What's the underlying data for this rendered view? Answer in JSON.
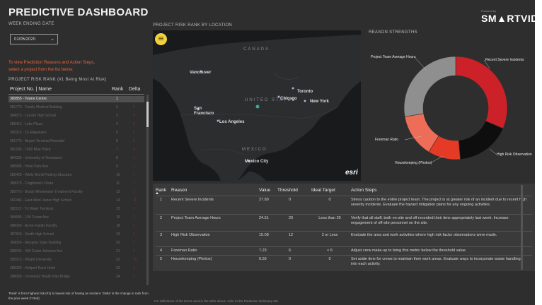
{
  "header": {
    "title": "PREDICTIVE DASHBOARD",
    "brand_tag": "Powered by",
    "brand": "SM▲RTVID.IO"
  },
  "filters": {
    "week_label": "WEEK ENDING DATE",
    "week_value": "01/05/2020"
  },
  "instructions": [
    "To view Prediction Reasons and Action Steps,",
    "select a project from the list below."
  ],
  "project_list": {
    "title": "PROJECT RISK RANK (#1 Being Most At Risk)",
    "headers": [
      "Project No. | Name",
      "Rank",
      "Delta"
    ],
    "rows": [
      {
        "name": "380855 - Towne Centre",
        "rank": "1",
        "delta": "0"
      },
      {
        "name": "381779 - Family Medical Building",
        "rank": "2",
        "delta": "0"
      },
      {
        "name": "384573 - Lincoln High School",
        "rank": "3",
        "delta": "0"
      },
      {
        "name": "389415 - Lake Plaza",
        "rank": "4",
        "delta": "0"
      },
      {
        "name": "390215 - 15 Edgewater",
        "rank": "5",
        "delta": "0"
      },
      {
        "name": "391775 - Airport Terminal Remodel",
        "rank": "6",
        "delta": "0"
      },
      {
        "name": "381295 - 1000 Blue Plaza",
        "rank": "7",
        "delta": "0"
      },
      {
        "name": "384335 - University of Tennessee",
        "rank": "8",
        "delta": "1"
      },
      {
        "name": "385995 - Hotel Park Ave",
        "rank": "9",
        "delta": "1"
      },
      {
        "name": "386425 - Wells World Parking Structure",
        "rank": "10",
        "delta": "1"
      },
      {
        "name": "389075 - Ciagbonet's Plaza",
        "rank": "11",
        "delta": "1"
      },
      {
        "name": "389775 - Brady Wholewater Treatment Facility",
        "rank": "12",
        "delta": "1"
      },
      {
        "name": "391484 - East West Junior High School",
        "rank": "14",
        "delta": "11"
      },
      {
        "name": "382115 - Tri Water Terminal",
        "rank": "15",
        "delta": "2"
      },
      {
        "name": "384685 - 100 Crown Ave",
        "rank": "16",
        "delta": "2"
      },
      {
        "name": "386005 - Acme Family Facility",
        "rank": "18",
        "delta": "2"
      },
      {
        "name": "387555 - Smith High School",
        "rank": "19",
        "delta": "2"
      },
      {
        "name": "389055 - Mesaine State Building",
        "rank": "20",
        "delta": "2"
      },
      {
        "name": "389034 - 400 Cedar Johnson Ave",
        "rank": "21",
        "delta": "2"
      },
      {
        "name": "385215 - Wright University",
        "rank": "22",
        "delta": "10"
      },
      {
        "name": "385025 - Heliport Rock Hotel",
        "rank": "23",
        "delta": "2"
      },
      {
        "name": "388085 - University Health Pan Bridge",
        "rank": "24",
        "delta": "2"
      }
    ]
  },
  "map": {
    "title": "PROJECT RISK RANK BY LOCATION",
    "countries": [
      "CANADA",
      "UNITED STATES",
      "MEXICO"
    ],
    "cities": [
      "Vancouver",
      "Toronto",
      "Chicago",
      "New York",
      "San Francisco",
      "Los Angeles",
      "Mexico City"
    ],
    "attribution": "esri"
  },
  "reason_strengths": {
    "title": "REASON STRENGTHS",
    "segments": [
      {
        "label": "Recent Severe Incidents",
        "value": 27.89,
        "color": "#cc2128"
      },
      {
        "label": "High Risk Observation",
        "value": 15.08,
        "color": "#0e0e0e"
      },
      {
        "label": "Housekeeping (Photos)",
        "value": 9.0,
        "color": "#e53a26"
      },
      {
        "label": "Foreman Ratio",
        "value": 12.0,
        "color": "#ed6d58"
      },
      {
        "label": "Project Team Average Hours",
        "value": 24.51,
        "color": "#8f8f8f"
      }
    ]
  },
  "reasons_table": {
    "headers": [
      "Rank",
      "Reason",
      "Value",
      "Threshold",
      "Ideal Target",
      "Action Steps"
    ],
    "rows": [
      {
        "rank": "1",
        "reason": "Recent Severe Incidents",
        "value": "27.89",
        "threshold": "0",
        "target": "0",
        "action": "Stress caution to the entire project team. The project is at greater risk of an incident due to recent high severity incidents. Evaluate the hazard mitigation plans for any ongoing activities."
      },
      {
        "rank": "2",
        "reason": "Project Team Average Hours",
        "value": "24.51",
        "threshold": "20",
        "target": "Less than 20",
        "action": "Verify that all staff, both on-site and off recorded their time appropriately last week. Increase engagement of off-site personnel on the site."
      },
      {
        "rank": "3",
        "reason": "High Risk Observation",
        "value": "15.08",
        "threshold": "12",
        "target": "2 or Less",
        "action": "Evaluate the area and work activities where high risk factor observations were made."
      },
      {
        "rank": "4",
        "reason": "Foreman Ratio",
        "value": "7.23",
        "threshold": "6",
        "target": "< 6",
        "action": "Adjust crew make-up to bring this metric below the threshold value."
      },
      {
        "rank": "5",
        "reason": "Housekeeping (Photos)",
        "value": "0.59",
        "threshold": "0",
        "target": "0",
        "action": "Set aside time for crews to maintain their work areas. Evaluate ways to incorporate waste handling into each activity."
      }
    ]
  },
  "footnotes": {
    "left": "'Rank' is from highest risk (#1) to lowest risk of having an incident. 'Delta' is the change in rank from the prior week (* Red)",
    "bottom": "For definitions of the terms used in the table above, refer to the Prediction dictionary tab."
  }
}
